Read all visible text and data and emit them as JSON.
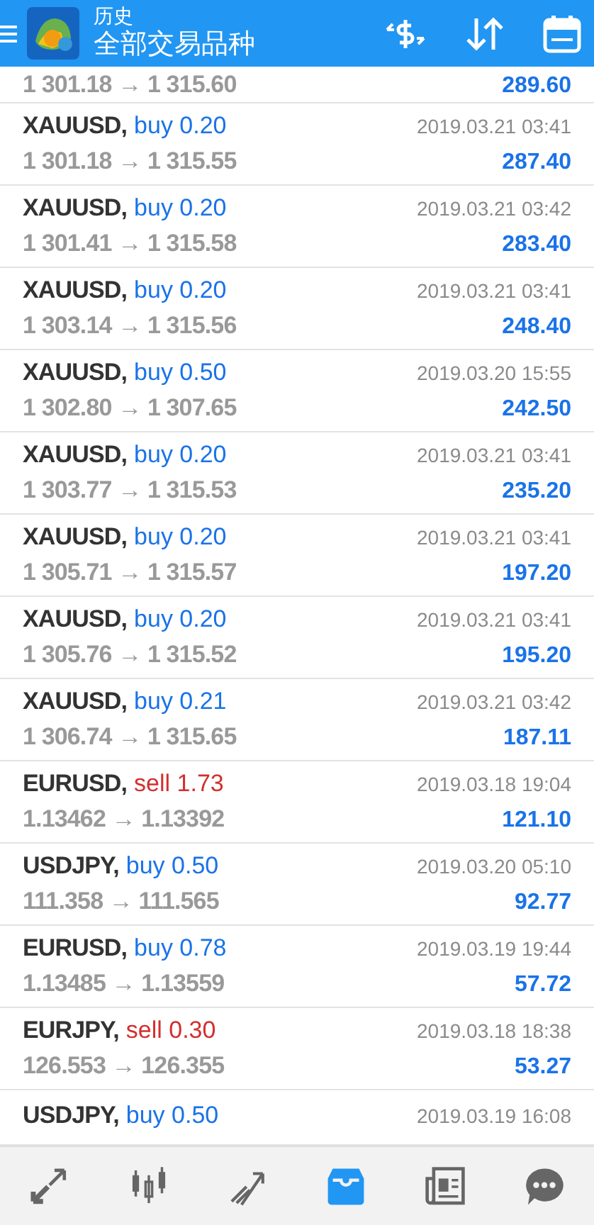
{
  "header": {
    "title": "历史",
    "subtitle": "全部交易品种"
  },
  "trades": [
    {
      "prices": "1 301.18 → 1 315.60",
      "profit": "289.60"
    },
    {
      "symbol": "XAUUSD,",
      "kind": "buy",
      "order": "buy 0.20",
      "time": "2019.03.21 03:41",
      "prices": "1 301.18 → 1 315.55",
      "profit": "287.40"
    },
    {
      "symbol": "XAUUSD,",
      "kind": "buy",
      "order": "buy 0.20",
      "time": "2019.03.21 03:42",
      "prices": "1 301.41 → 1 315.58",
      "profit": "283.40"
    },
    {
      "symbol": "XAUUSD,",
      "kind": "buy",
      "order": "buy 0.20",
      "time": "2019.03.21 03:41",
      "prices": "1 303.14 → 1 315.56",
      "profit": "248.40"
    },
    {
      "symbol": "XAUUSD,",
      "kind": "buy",
      "order": "buy 0.50",
      "time": "2019.03.20 15:55",
      "prices": "1 302.80 → 1 307.65",
      "profit": "242.50"
    },
    {
      "symbol": "XAUUSD,",
      "kind": "buy",
      "order": "buy 0.20",
      "time": "2019.03.21 03:41",
      "prices": "1 303.77 → 1 315.53",
      "profit": "235.20"
    },
    {
      "symbol": "XAUUSD,",
      "kind": "buy",
      "order": "buy 0.20",
      "time": "2019.03.21 03:41",
      "prices": "1 305.71 → 1 315.57",
      "profit": "197.20"
    },
    {
      "symbol": "XAUUSD,",
      "kind": "buy",
      "order": "buy 0.20",
      "time": "2019.03.21 03:41",
      "prices": "1 305.76 → 1 315.52",
      "profit": "195.20"
    },
    {
      "symbol": "XAUUSD,",
      "kind": "buy",
      "order": "buy 0.21",
      "time": "2019.03.21 03:42",
      "prices": "1 306.74 → 1 315.65",
      "profit": "187.11"
    },
    {
      "symbol": "EURUSD,",
      "kind": "sell",
      "order": "sell 1.73",
      "time": "2019.03.18 19:04",
      "prices": "1.13462 → 1.13392",
      "profit": "121.10"
    },
    {
      "symbol": "USDJPY,",
      "kind": "buy",
      "order": "buy 0.50",
      "time": "2019.03.20 05:10",
      "prices": "111.358 → 111.565",
      "profit": "92.77"
    },
    {
      "symbol": "EURUSD,",
      "kind": "buy",
      "order": "buy 0.78",
      "time": "2019.03.19 19:44",
      "prices": "1.13485 → 1.13559",
      "profit": "57.72"
    },
    {
      "symbol": "EURJPY,",
      "kind": "sell",
      "order": "sell 0.30",
      "time": "2019.03.18 18:38",
      "prices": "126.553 → 126.355",
      "profit": "53.27"
    },
    {
      "symbol": "USDJPY,",
      "kind": "buy",
      "order": "buy 0.50",
      "time": "2019.03.19 16:08"
    }
  ],
  "nav": [
    {
      "kind": "quotes",
      "selected": false
    },
    {
      "kind": "chart",
      "selected": false
    },
    {
      "kind": "trade",
      "selected": false
    },
    {
      "kind": "history",
      "selected": true
    },
    {
      "kind": "news",
      "selected": false
    },
    {
      "kind": "chat",
      "selected": false
    }
  ]
}
